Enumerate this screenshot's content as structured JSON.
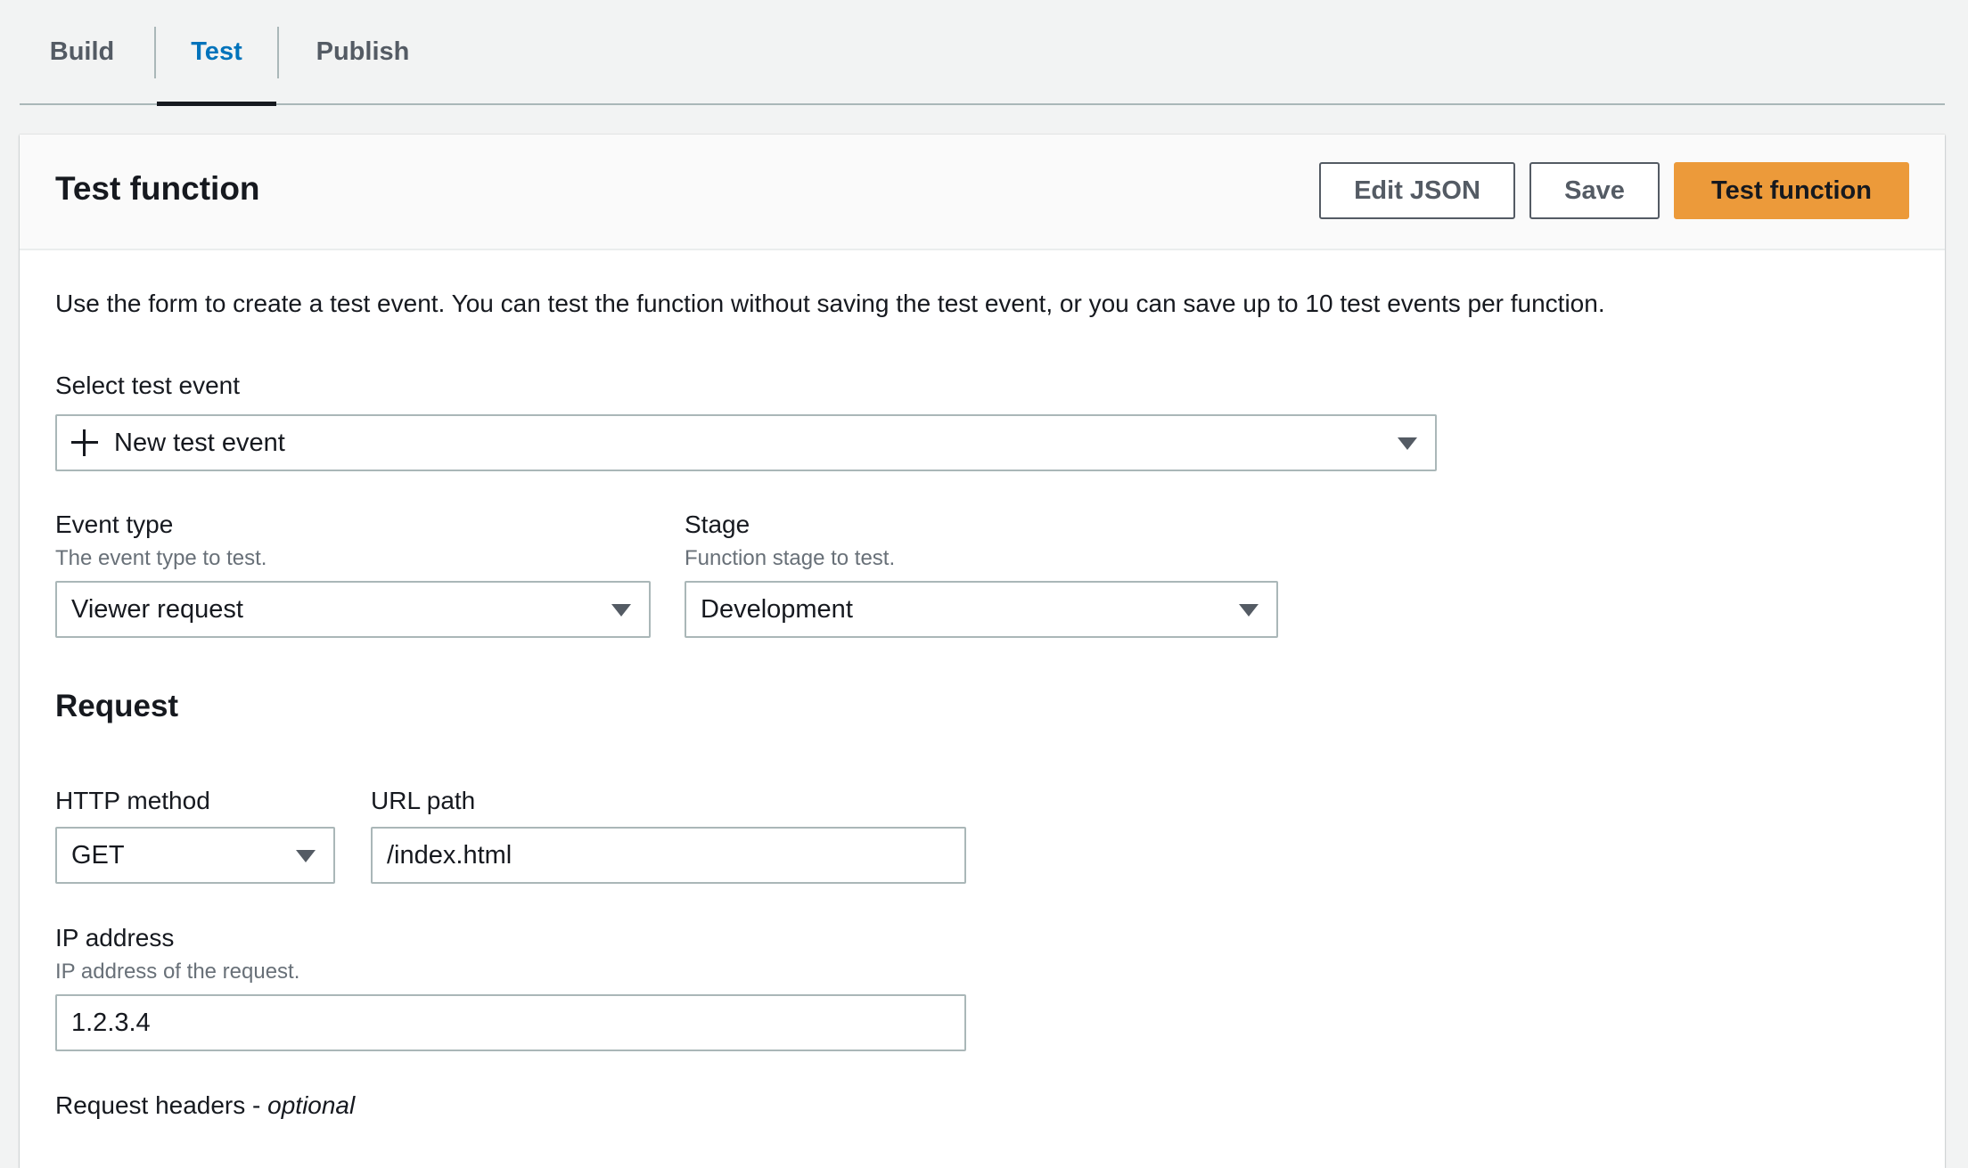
{
  "tabs": [
    {
      "label": "Build"
    },
    {
      "label": "Test"
    },
    {
      "label": "Publish"
    }
  ],
  "active_tab": "Test",
  "panel": {
    "title": "Test function",
    "buttons": {
      "edit_json": "Edit JSON",
      "save": "Save",
      "test_function": "Test function"
    },
    "description": "Use the form to create a test event. You can test the function without saving the test event, or you can save up to 10 test events per function."
  },
  "select_test_event": {
    "label": "Select test event",
    "value": "New test event"
  },
  "event_type": {
    "label": "Event type",
    "hint": "The event type to test.",
    "value": "Viewer request"
  },
  "stage": {
    "label": "Stage",
    "hint": "Function stage to test.",
    "value": "Development"
  },
  "request": {
    "title": "Request",
    "http_method": {
      "label": "HTTP method",
      "value": "GET"
    },
    "url_path": {
      "label": "URL path",
      "value": "/index.html"
    },
    "ip_address": {
      "label": "IP address",
      "hint": "IP address of the request.",
      "value": "1.2.3.4"
    },
    "headers": {
      "label": "Request headers - ",
      "optional": "optional"
    }
  },
  "colors": {
    "accent_blue": "#0073bb",
    "primary_button": "#ec9a3a",
    "background": "#f2f3f3",
    "border": "#aab7b8"
  }
}
